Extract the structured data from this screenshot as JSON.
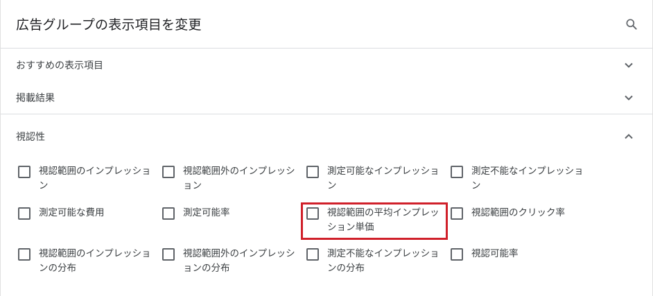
{
  "header": {
    "title": "広告グループの表示項目を変更",
    "search_icon": "search-icon"
  },
  "sections": [
    {
      "label": "おすすめの表示項目",
      "state": "collapsed",
      "icon": "chevron-down-icon"
    },
    {
      "label": "掲載結果",
      "state": "collapsed",
      "icon": "chevron-down-icon"
    },
    {
      "label": "視認性",
      "state": "expanded",
      "icon": "chevron-up-icon"
    }
  ],
  "visibility_items": [
    {
      "label": "視認範囲のインプレッション",
      "checked": false
    },
    {
      "label": "視認範囲外のインプレッション",
      "checked": false
    },
    {
      "label": "測定可能なインプレッション",
      "checked": false
    },
    {
      "label": "測定不能なインプレッション",
      "checked": false
    },
    {
      "label": "測定可能な費用",
      "checked": false
    },
    {
      "label": "測定可能率",
      "checked": false
    },
    {
      "label": "視認範囲の平均インプレッション単価",
      "checked": false,
      "highlighted": true
    },
    {
      "label": "視認範囲のクリック率",
      "checked": false
    },
    {
      "label": "視認範囲のインプレッションの分布",
      "checked": false
    },
    {
      "label": "視認範囲外のインプレッションの分布",
      "checked": false
    },
    {
      "label": "測定不能なインプレッションの分布",
      "checked": false
    },
    {
      "label": "視認可能率",
      "checked": false
    }
  ],
  "colors": {
    "highlight_border": "#d0202a",
    "checkbox_border": "#5f6368",
    "divider": "#dadce0"
  }
}
